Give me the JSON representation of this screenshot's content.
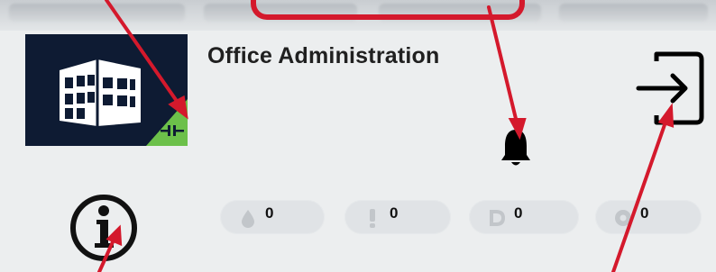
{
  "header": {
    "title": "Office Administration"
  },
  "tile": {
    "icon": "building-icon",
    "status_icon": "connector-icon",
    "status_color": "#6cc04a",
    "background": "#0e1b33"
  },
  "alarm": {
    "icon": "bell-icon"
  },
  "logout": {
    "icon": "logout-icon"
  },
  "info": {
    "icon": "info-icon"
  },
  "counters": [
    {
      "icon": "water-drop-icon",
      "value": "0"
    },
    {
      "icon": "exclamation-icon",
      "value": "0"
    },
    {
      "icon": "d-letter-icon",
      "value": "0"
    },
    {
      "icon": "gear-icon",
      "value": "0"
    }
  ],
  "annotation_color": "#d4192c"
}
